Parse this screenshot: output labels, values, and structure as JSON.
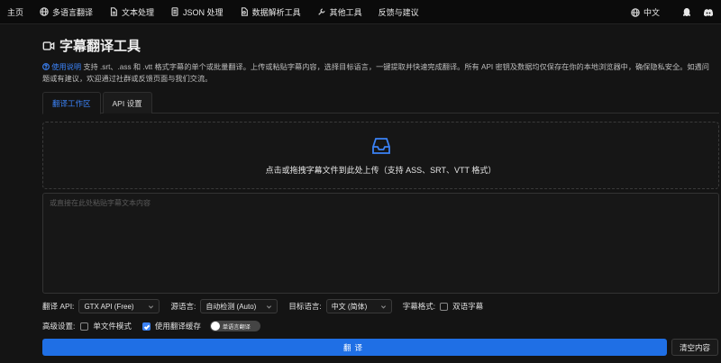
{
  "nav": {
    "home": "主页",
    "multi_translate": "多语言翻译",
    "text_processing": "文本处理",
    "json_processing": "JSON 处理",
    "data_parsing": "数据解析工具",
    "other_tools": "其他工具",
    "feedback": "反馈与建议",
    "language": "中文"
  },
  "page": {
    "title": "字幕翻译工具",
    "help_link": "使用说明",
    "intro": "支持 .srt、.ass 和 .vtt 格式字幕的单个或批量翻译。上传或粘贴字幕内容，选择目标语言，一键提取并快速完成翻译。所有 API 密钥及数据均仅保存在你的本地浏览器中，确保隐私安全。如遇问题或有建议，欢迎通过社群或反馈页面与我们交流。"
  },
  "tabs": [
    {
      "label": "翻译工作区",
      "active": true
    },
    {
      "label": "API 设置",
      "active": false
    }
  ],
  "upload": {
    "text": "点击或拖拽字幕文件到此处上传（支持 ASS、SRT、VTT 格式）"
  },
  "textarea": {
    "placeholder": "或直接在此处粘贴字幕文本内容",
    "value": ""
  },
  "options": {
    "api_label": "翻译 API:",
    "api_value": "GTX API (Free)",
    "source_label": "源语言:",
    "source_value": "自动检测 (Auto)",
    "target_label": "目标语言:",
    "target_value": "中文 (简体)",
    "format_label": "字幕格式:",
    "bilingual_label": "双语字幕",
    "bilingual_checked": false,
    "advanced_label": "高级设置:",
    "single_file_label": "单文件模式",
    "single_file_checked": false,
    "cache_label": "使用翻译缓存",
    "cache_checked": true,
    "toggle_label": "单语言翻译"
  },
  "buttons": {
    "translate": "翻译",
    "clear": "清空内容"
  },
  "colors": {
    "accent": "#1f6fe5",
    "link": "#3b82f6",
    "background": "#141414"
  }
}
